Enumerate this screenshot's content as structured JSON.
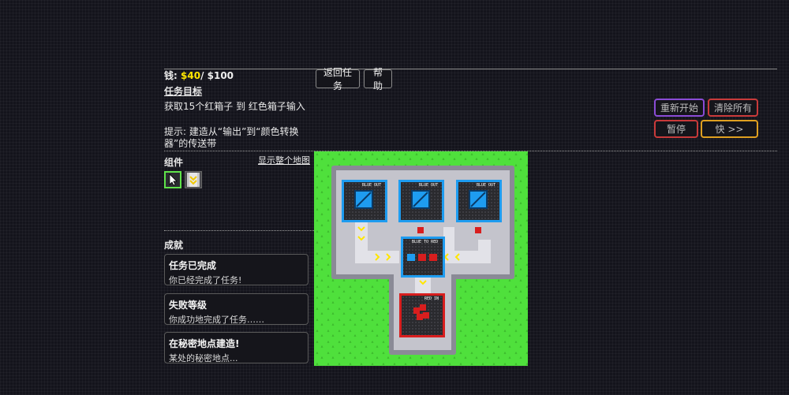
{
  "money": {
    "label": "钱:",
    "current": "$40",
    "separator": "/ ",
    "target": "$100"
  },
  "goal": {
    "title": "任务目标",
    "text": "获取15个红箱子 到 红色箱子输入",
    "hint": "提示: 建造从“输出”到“颜色转换器”的传送带"
  },
  "buttons": {
    "back": "返回任务",
    "help": "帮助"
  },
  "controls": {
    "restart": "重新开始",
    "clear": "清除所有",
    "pause": "暂停",
    "fast": "快 >>",
    "colors": {
      "restart": "#8a4bd6",
      "clear": "#c93a3a",
      "pause": "#c93a3a",
      "fast": "#e0a020"
    }
  },
  "parts": {
    "title": "组件",
    "show_map": "显示整个地图",
    "tools": [
      {
        "name": "pointer-icon",
        "selected": true
      },
      {
        "name": "conveyor-icon",
        "selected": false
      }
    ]
  },
  "achievements": {
    "title": "成就",
    "items": [
      {
        "title": "任务已完成",
        "desc": "你已经完成了任务!"
      },
      {
        "title": "失败等级",
        "desc": "你成功地完成了任务……"
      },
      {
        "title": "在秘密地点建造!",
        "desc": "某处的秘密地点..."
      }
    ]
  },
  "map": {
    "labels": {
      "blue_out": "BLUE OUT",
      "blue_to_red": "BLUE TO RED",
      "red_in": "RED IN"
    },
    "colors": {
      "grass": "#4fe03c",
      "blue": "#1e9cf0",
      "red": "#d81e1e",
      "belt_arrow": "#ffe600",
      "wall": "#8a8a96"
    }
  }
}
